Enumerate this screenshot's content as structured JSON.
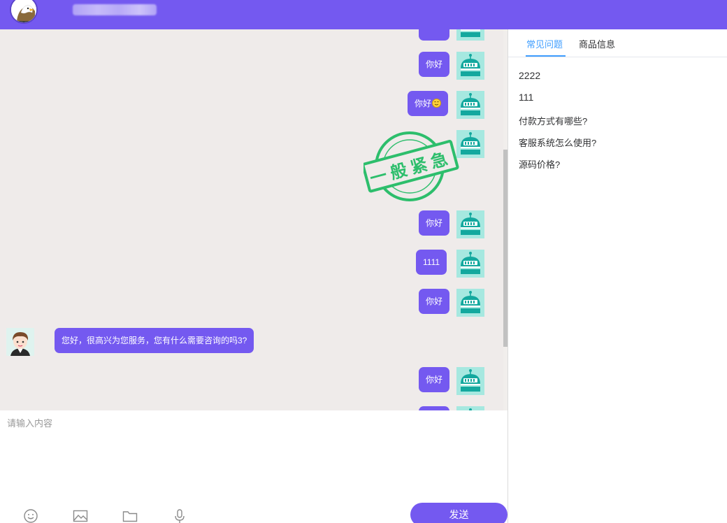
{
  "header": {
    "title": "██████"
  },
  "chat": {
    "messages": [
      {
        "side": "right",
        "text": "你好"
      },
      {
        "side": "right",
        "text": "你好",
        "emoji": "smile-emoji"
      },
      {
        "side": "right",
        "text": "你好"
      },
      {
        "side": "right",
        "text": "1111"
      },
      {
        "side": "right",
        "text": "你好"
      },
      {
        "side": "left",
        "text": "您好，很高兴为您服务，您有什么需要咨询的吗3?"
      },
      {
        "side": "right",
        "text": "你好"
      }
    ],
    "stamp_text": "一般紧急"
  },
  "input": {
    "placeholder": "请输入内容",
    "send_label": "发送",
    "tools": [
      "smile-icon",
      "image-icon",
      "folder-icon",
      "microphone-icon"
    ]
  },
  "side_panel": {
    "tabs": [
      {
        "label": "常见问题",
        "active": true
      },
      {
        "label": "商品信息",
        "active": false
      }
    ],
    "faq": [
      "2222",
      "111",
      "付款方式有哪些?",
      "客服系统怎么使用?",
      "源码价格?"
    ]
  },
  "colors": {
    "brand": "#7459f0",
    "tab_active": "#409eff",
    "stamp": "#2dbe6c",
    "chat_bg": "#efebea"
  }
}
